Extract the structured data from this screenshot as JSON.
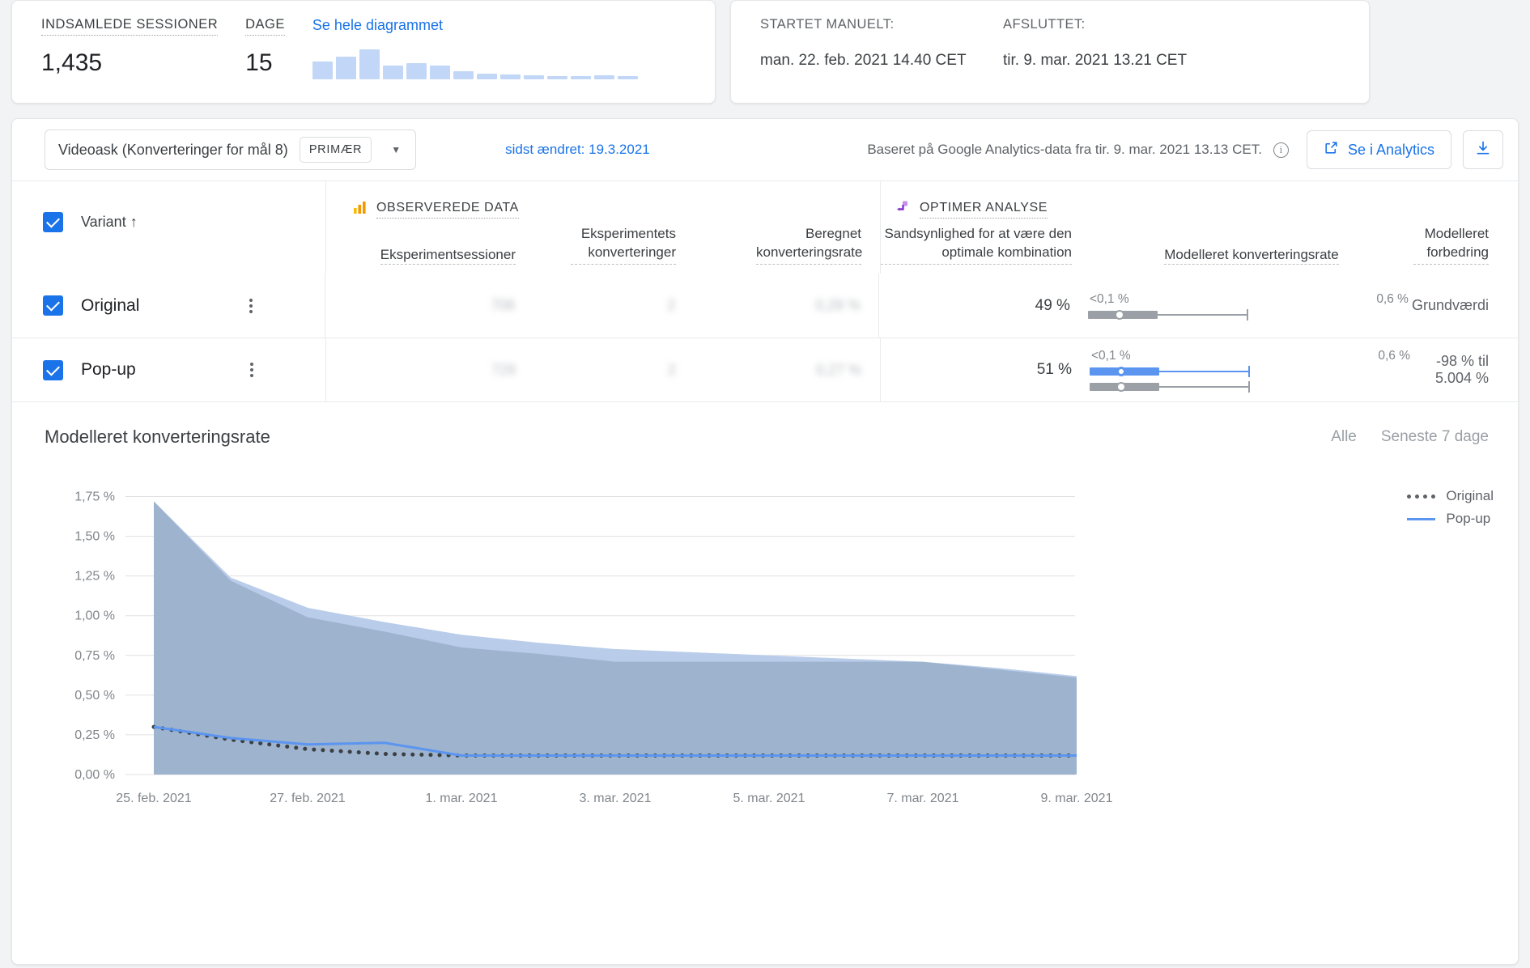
{
  "summary": {
    "sessions_label": "INDSAMLEDE SESSIONER",
    "sessions_value": "1,435",
    "days_label": "DAGE",
    "days_value": "15",
    "see_chart_link": "Se hele diagrammet",
    "sparkline": [
      22,
      28,
      37,
      17,
      20,
      17,
      10,
      7,
      6,
      5,
      4,
      4,
      5,
      4
    ]
  },
  "dates": {
    "started_label": "STARTET MANUELT:",
    "started_value": "man. 22. feb. 2021 14.40 CET",
    "ended_label": "AFSLUTTET:",
    "ended_value": "tir. 9. mar. 2021 13.21 CET"
  },
  "toolbar": {
    "goal": "Videoask (Konverteringer for mål 8)",
    "primary_chip": "PRIMÆR",
    "caret_icon": "chevron-down-icon",
    "modified": "sidst ændret: 19.3.2021",
    "based_on": "Baseret på Google Analytics-data fra tir. 9. mar. 2021 13.13 CET.",
    "info_icon": "info-icon",
    "analytics_button": "Se i Analytics",
    "external_link_icon": "external-link-icon",
    "download_icon": "download-icon"
  },
  "table": {
    "observed_section": "OBSERVEREDE DATA",
    "observed_icon": "bar-chart-icon",
    "optimize_section": "OPTIMER ANALYSE",
    "optimize_icon": "optimize-icon",
    "headers": {
      "variant": "Variant ↑",
      "sessions": "Eksperimentsessioner",
      "conversions": "Eksperimentets konverteringer",
      "calc_rate": "Beregnet konverteringsrate",
      "probability": "Sandsynlighed for at være den optimale kombination",
      "modelled_rate": "Modelleret konverteringsrate",
      "modelled_improvement": "Modelleret forbedring"
    },
    "rows": [
      {
        "name": "Original",
        "sessions": "706",
        "conversions": "2",
        "calc_rate": "0,28 %",
        "probability": "49 %",
        "ci_low": "<0,1 %",
        "ci_high": "0,6 %",
        "improvement": "Grundværdi",
        "highlighted": false
      },
      {
        "name": "Pop-up",
        "sessions": "729",
        "conversions": "2",
        "calc_rate": "0,27 %",
        "probability": "51 %",
        "ci_low": "<0,1 %",
        "ci_high": "0,6 %",
        "improvement": "-98 % til 5.004 %",
        "highlighted": true
      }
    ]
  },
  "chart_panel": {
    "title": "Modelleret konverteringsrate",
    "tabs": [
      {
        "label": "Alle",
        "active": true
      },
      {
        "label": "Seneste 7 dage",
        "active": false
      }
    ]
  },
  "colors": {
    "accent_blue": "#1a73e8",
    "line_blue": "#5b95f0",
    "band_light": "#b9ccea",
    "band_dark": "#98aec9",
    "grey_track": "#9aa0a6",
    "original_dash": "#3c4043"
  },
  "chart_data": {
    "type": "area",
    "title": "Modelleret konverteringsrate",
    "xlabel": "",
    "ylabel": "",
    "ylim": [
      0.0,
      1.875
    ],
    "ytick_labels": [
      "1,75 %",
      "1,50 %",
      "1,25 %",
      "1,00 %",
      "0,75 %",
      "0,50 %",
      "0,25 %",
      "0,00 %"
    ],
    "ytick_values": [
      1.75,
      1.5,
      1.25,
      1.0,
      0.75,
      0.5,
      0.25,
      0.0
    ],
    "xtick_labels": [
      "25. feb. 2021",
      "27. feb. 2021",
      "1. mar. 2021",
      "3. mar. 2021",
      "5. mar. 2021",
      "7. mar. 2021",
      "9. mar. 2021"
    ],
    "x": [
      "25. feb. 2021",
      "26. feb. 2021",
      "27. feb. 2021",
      "28. feb. 2021",
      "1. mar. 2021",
      "2. mar. 2021",
      "3. mar. 2021",
      "4. mar. 2021",
      "5. mar. 2021",
      "6. mar. 2021",
      "7. mar. 2021",
      "8. mar. 2021",
      "9. mar. 2021"
    ],
    "grid": true,
    "legend_position": "right",
    "series": [
      {
        "name": "Original",
        "style": "dotted",
        "color": "#3c4043",
        "values": [
          0.3,
          0.22,
          0.16,
          0.13,
          0.12,
          0.12,
          0.12,
          0.12,
          0.12,
          0.12,
          0.12,
          0.12,
          0.12
        ],
        "band_upper": [
          1.72,
          1.22,
          0.99,
          0.9,
          0.8,
          0.76,
          0.71,
          0.71,
          0.71,
          0.71,
          0.71,
          0.66,
          0.61
        ]
      },
      {
        "name": "Pop-up",
        "style": "solid",
        "color": "#5b95f0",
        "values": [
          0.3,
          0.23,
          0.19,
          0.2,
          0.12,
          0.12,
          0.12,
          0.12,
          0.12,
          0.12,
          0.12,
          0.12,
          0.12
        ],
        "band_upper": [
          1.72,
          1.24,
          1.05,
          0.96,
          0.88,
          0.83,
          0.79,
          0.77,
          0.75,
          0.73,
          0.71,
          0.67,
          0.62
        ]
      }
    ]
  }
}
